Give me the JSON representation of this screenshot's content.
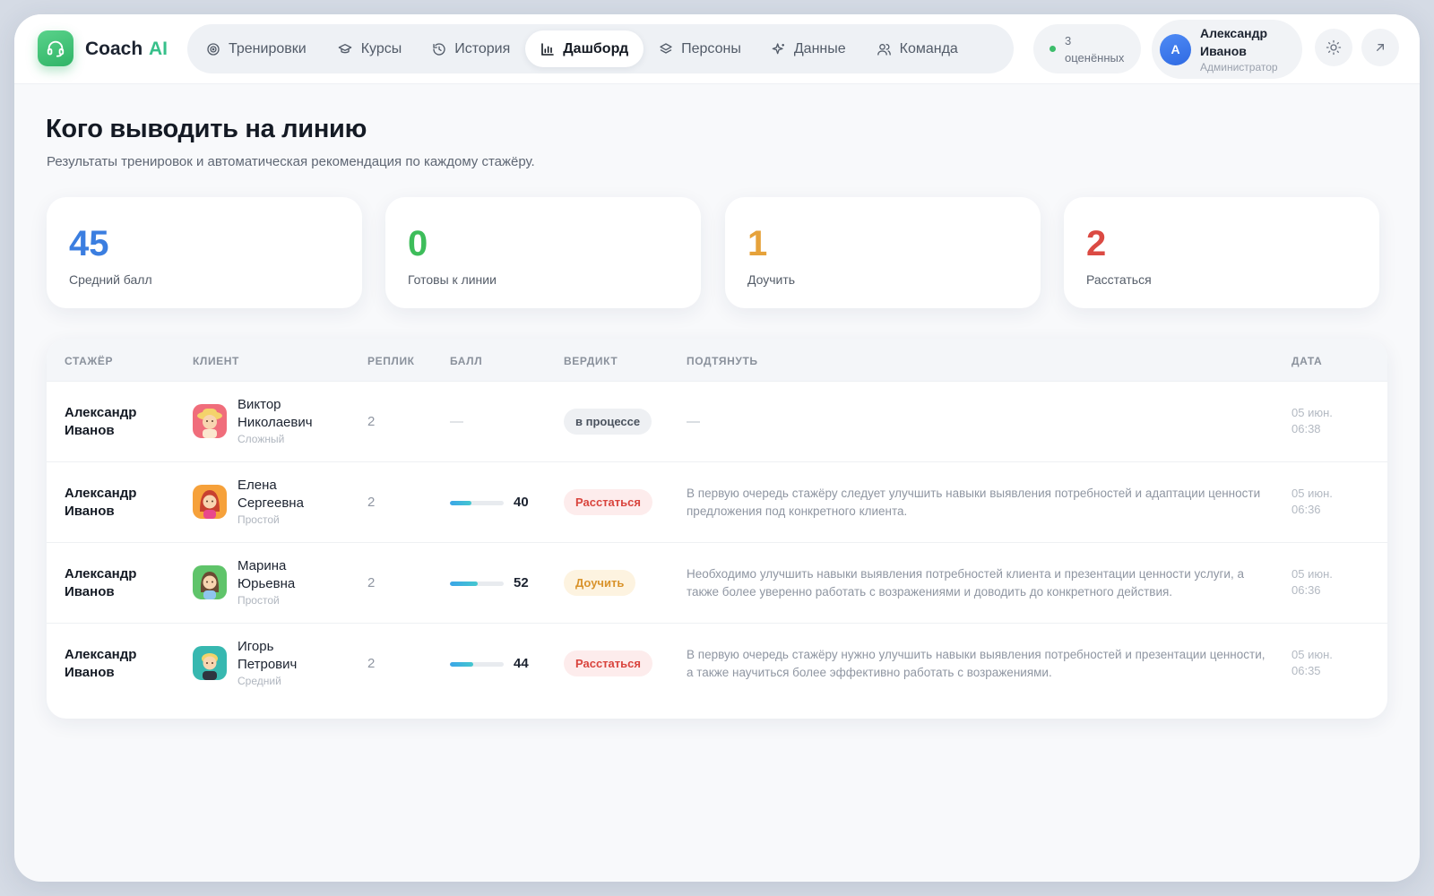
{
  "brand": {
    "name": "Coach",
    "suffix": "AI"
  },
  "nav": {
    "items": [
      {
        "label": "Тренировки",
        "icon": "target-icon"
      },
      {
        "label": "Курсы",
        "icon": "graduation-cap-icon"
      },
      {
        "label": "История",
        "icon": "history-icon"
      },
      {
        "label": "Дашборд",
        "icon": "bar-chart-icon",
        "active": true
      },
      {
        "label": "Персоны",
        "icon": "layers-icon"
      },
      {
        "label": "Данные",
        "icon": "sparkles-icon"
      },
      {
        "label": "Команда",
        "icon": "users-icon"
      }
    ]
  },
  "status": {
    "count": "3",
    "label": "оценённых"
  },
  "user": {
    "initial": "А",
    "first_name": "Александр",
    "last_name": "Иванов",
    "role": "Администратор"
  },
  "page": {
    "title": "Кого выводить на линию",
    "subtitle": "Результаты тренировок и автоматическая рекомендация по каждому стажёру."
  },
  "stats": [
    {
      "value": "45",
      "label": "Средний балл",
      "color": "#3b7ee0"
    },
    {
      "value": "0",
      "label": "Готовы к линии",
      "color": "#3dbd5a"
    },
    {
      "value": "1",
      "label": "Доучить",
      "color": "#e6a23a"
    },
    {
      "value": "2",
      "label": "Расстаться",
      "color": "#db4a43"
    }
  ],
  "table": {
    "headers": {
      "trainee": "СТАЖЁР",
      "client": "КЛИЕНТ",
      "replies": "РЕПЛИК",
      "score": "БАЛЛ",
      "verdict": "ВЕРДИКТ",
      "improve": "ПОДТЯНУТЬ",
      "date": "ДАТА"
    },
    "rows": [
      {
        "trainee_first": "Александр",
        "trainee_last": "Иванов",
        "client_first": "Виктор",
        "client_last": "Николаевич",
        "client_level": "Сложный",
        "replies": "2",
        "score": null,
        "score_placeholder": "—",
        "verdict": "в процессе",
        "improve": "—",
        "date": "05 июн.",
        "time": "06:38"
      },
      {
        "trainee_first": "Александр",
        "trainee_last": "Иванов",
        "client_first": "Елена",
        "client_last": "Сергеевна",
        "client_level": "Простой",
        "replies": "2",
        "score": "40",
        "verdict": "Расстаться",
        "improve": "В первую очередь стажёру следует улучшить навыки выявления потребностей и адаптации ценности предложения под конкретного клиента.",
        "date": "05 июн.",
        "time": "06:36"
      },
      {
        "trainee_first": "Александр",
        "trainee_last": "Иванов",
        "client_first": "Марина",
        "client_last": "Юрьевна",
        "client_level": "Простой",
        "replies": "2",
        "score": "52",
        "verdict": "Доучить",
        "improve": "Необходимо улучшить навыки выявления потребностей клиента и презентации ценности услуги, а также более уверенно работать с возражениями и доводить до конкретного действия.",
        "date": "05 июн.",
        "time": "06:36"
      },
      {
        "trainee_first": "Александр",
        "trainee_last": "Иванов",
        "client_first": "Игорь",
        "client_last": "Петрович",
        "client_level": "Средний",
        "replies": "2",
        "score": "44",
        "verdict": "Расстаться",
        "improve": "В первую очередь стажёру нужно улучшить навыки выявления потребностей и презентации ценности, а также научиться более эффективно работать с возражениями.",
        "date": "05 июн.",
        "time": "06:35"
      }
    ]
  },
  "colors": {
    "accent_green": "#2fb466",
    "badge_process_bg": "#eef0f3",
    "badge_part_bg": "#fdecec",
    "badge_part_fg": "#d9443d",
    "badge_learn_bg": "#fdf3e0",
    "badge_learn_fg": "#d9932b"
  }
}
